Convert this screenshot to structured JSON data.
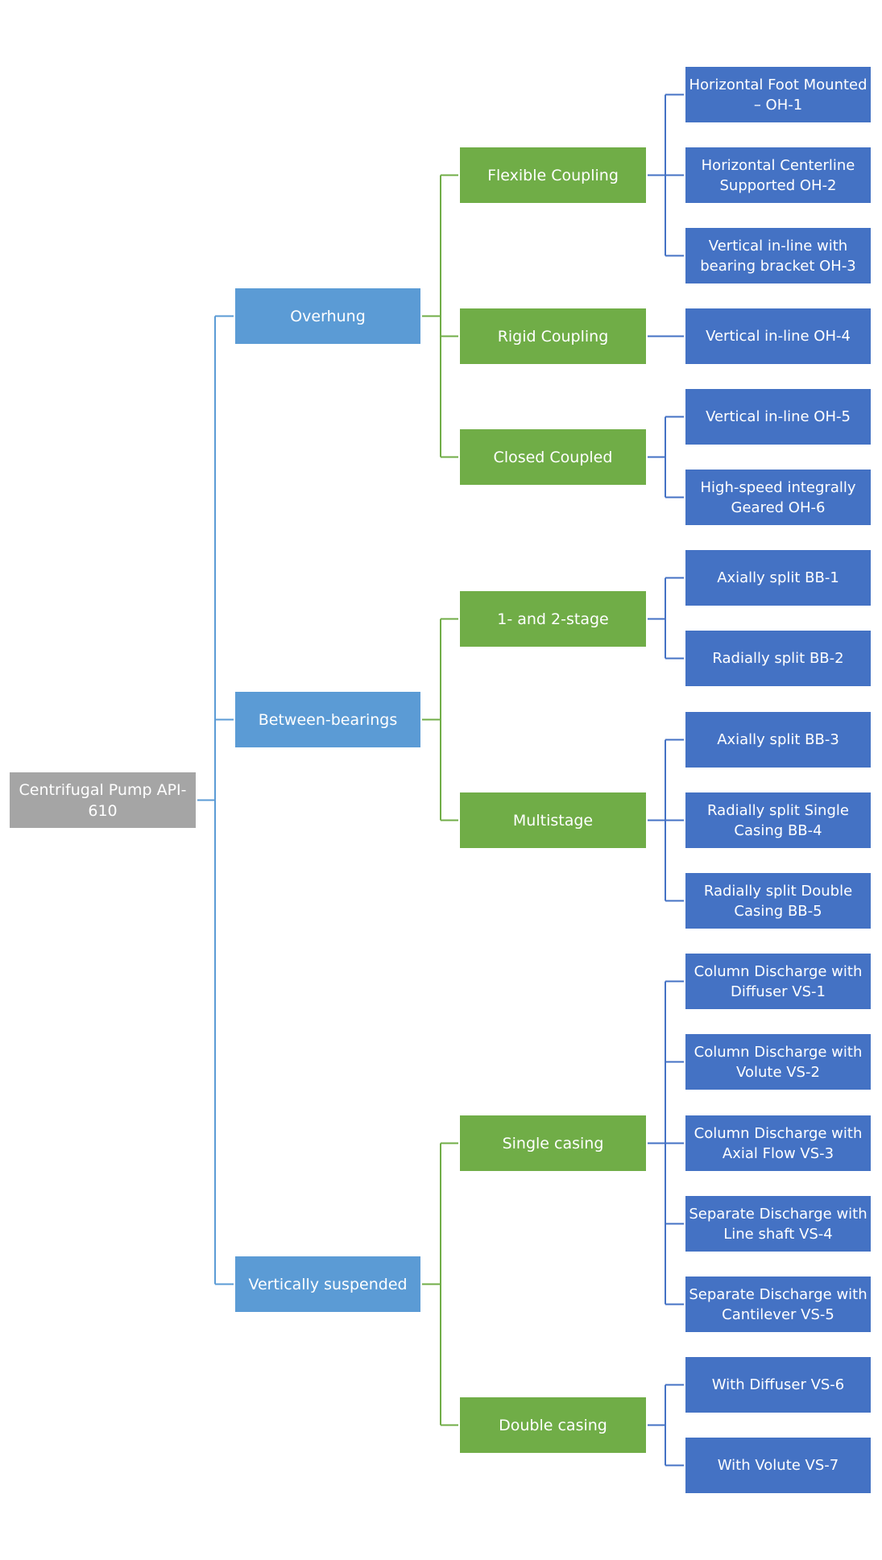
{
  "title": "Centrifugal Pump API-610",
  "colors": {
    "root": "#a5a5a5",
    "level1": "#5b9bd5",
    "level2": "#70ad47",
    "level3": "#4472c4",
    "connector_level0": "#5b9bd5",
    "connector_level1": "#70ad47",
    "connector_level2": "#4472c4"
  },
  "tree": {
    "label": "Centrifugal Pump API-610",
    "children": [
      {
        "label": "Overhung",
        "children": [
          {
            "label": "Flexible Coupling",
            "children": [
              {
                "label": "Horizontal Foot Mounted – OH-1"
              },
              {
                "label": "Horizontal Centerline Supported OH-2"
              },
              {
                "label": "Vertical in-line with bearing bracket OH-3"
              }
            ]
          },
          {
            "label": "Rigid Coupling",
            "children": [
              {
                "label": "Vertical in-line OH-4"
              }
            ]
          },
          {
            "label": "Closed Coupled",
            "children": [
              {
                "label": "Vertical in-line OH-5"
              },
              {
                "label": "High-speed integrally Geared OH-6"
              }
            ]
          }
        ]
      },
      {
        "label": "Between-bearings",
        "children": [
          {
            "label": "1- and 2-stage",
            "children": [
              {
                "label": "Axially split BB-1"
              },
              {
                "label": "Radially split BB-2"
              }
            ]
          },
          {
            "label": "Multistage",
            "children": [
              {
                "label": "Axially split BB-3"
              },
              {
                "label": "Radially split Single Casing BB-4"
              },
              {
                "label": "Radially split Double Casing BB-5"
              }
            ]
          }
        ]
      },
      {
        "label": "Vertically suspended",
        "children": [
          {
            "label": "Single casing",
            "children": [
              {
                "label": "Column Discharge with Diffuser VS-1"
              },
              {
                "label": "Column Discharge with Volute VS-2"
              },
              {
                "label": "Column Discharge with Axial Flow VS-3"
              },
              {
                "label": "Separate Discharge with Line shaft VS-4"
              },
              {
                "label": "Separate Discharge with Cantilever VS-5"
              }
            ]
          },
          {
            "label": "Double casing",
            "children": [
              {
                "label": "With Diffuser VS-6"
              },
              {
                "label": "With Volute VS-7"
              }
            ]
          }
        ]
      }
    ]
  }
}
